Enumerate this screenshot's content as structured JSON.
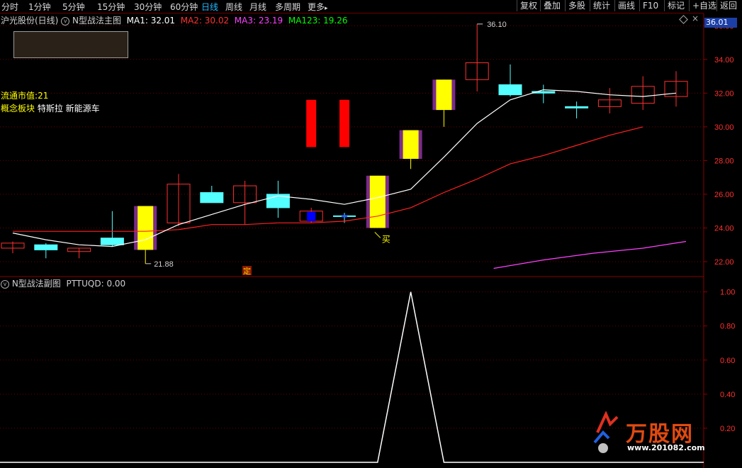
{
  "toolbar": {
    "periods": [
      "分时",
      "1分钟",
      "5分钟",
      "15分钟",
      "30分钟",
      "60分钟",
      "日线",
      "周线",
      "月线",
      "多周期",
      "更多"
    ],
    "more_arrow": "▸",
    "active_index": 6,
    "right_buttons": [
      "复权",
      "叠加",
      "多股",
      "统计",
      "画线",
      "F10",
      "标记",
      "+自选",
      "返回"
    ]
  },
  "main_panel": {
    "stock_title": "沪光股份(日线)",
    "indicator_name": "N型战法主图",
    "collapse_icon": "v",
    "ma": [
      {
        "label": "MA1: 32.01",
        "color": "#ffffff"
      },
      {
        "label": "MA2: 30.02",
        "color": "#ff3030"
      },
      {
        "label": "MA3: 23.19",
        "color": "#ff40ff"
      },
      {
        "label": "MA123: 19.26",
        "color": "#00ff00"
      }
    ],
    "info_lines": [
      {
        "label": "流通市值",
        "value": "21"
      },
      {
        "label": "概念板块",
        "value": "特斯拉 新能源车"
      }
    ],
    "last_price_tag": "36.01",
    "close_icon": "×",
    "annotations": {
      "high": "36.10",
      "low": "21.88",
      "buy": "买",
      "ding": "定"
    }
  },
  "sub_panel": {
    "title": "N型战法副图",
    "indicator_label": "PTTUQD: 0.00"
  },
  "watermark": {
    "brand": "万股网",
    "url": "www.201082.com"
  },
  "chart_data": [
    {
      "type": "candlestick",
      "y_ticks": [
        "22.00",
        "24.00",
        "26.00",
        "28.00",
        "30.00",
        "32.00",
        "34.00",
        "36.00"
      ],
      "ylim": [
        21.2,
        36.6
      ],
      "candles": [
        {
          "o": 22.8,
          "h": 23.2,
          "l": 22.5,
          "c": 23.1,
          "k": "up"
        },
        {
          "o": 23.0,
          "h": 23.1,
          "l": 22.2,
          "c": 22.7,
          "k": "down"
        },
        {
          "o": 22.8,
          "h": 22.8,
          "l": 22.2,
          "c": 22.6,
          "k": "up"
        },
        {
          "o": 23.0,
          "h": 25.0,
          "l": 22.9,
          "c": 23.4,
          "k": "down"
        },
        {
          "o": 22.7,
          "h": 25.3,
          "l": 21.88,
          "c": 25.3,
          "k": "signal"
        },
        {
          "o": 24.3,
          "h": 27.2,
          "l": 24.1,
          "c": 26.6,
          "k": "up"
        },
        {
          "o": 26.1,
          "h": 26.5,
          "l": 25.5,
          "c": 25.5,
          "k": "down"
        },
        {
          "o": 26.5,
          "h": 26.8,
          "l": 24.2,
          "c": 25.5,
          "k": "up"
        },
        {
          "o": 26.0,
          "h": 26.8,
          "l": 24.6,
          "c": 25.2,
          "k": "down"
        },
        {
          "o": 25.0,
          "h": 25.2,
          "l": 24.3,
          "c": 24.4,
          "k": "blue"
        },
        {
          "o": 24.8,
          "h": 24.9,
          "l": 24.3,
          "c": 24.7,
          "k": "doji"
        },
        {
          "o": 24.0,
          "h": 27.1,
          "l": 24.0,
          "c": 27.1,
          "k": "signal"
        },
        {
          "o": 28.1,
          "h": 29.8,
          "l": 27.5,
          "c": 29.8,
          "k": "signal"
        },
        {
          "o": 31.0,
          "h": 32.8,
          "l": 30.0,
          "c": 32.8,
          "k": "signal"
        },
        {
          "o": 32.8,
          "h": 36.1,
          "l": 32.1,
          "c": 33.8,
          "k": "up"
        },
        {
          "o": 32.5,
          "h": 33.7,
          "l": 31.8,
          "c": 31.9,
          "k": "down"
        },
        {
          "o": 32.1,
          "h": 32.5,
          "l": 31.4,
          "c": 32.0,
          "k": "down"
        },
        {
          "o": 31.2,
          "h": 31.5,
          "l": 30.5,
          "c": 31.2,
          "k": "down"
        },
        {
          "o": 31.2,
          "h": 32.3,
          "l": 30.8,
          "c": 31.6,
          "k": "up"
        },
        {
          "o": 31.4,
          "h": 33.0,
          "l": 31.0,
          "c": 32.4,
          "k": "up"
        },
        {
          "o": 31.8,
          "h": 33.3,
          "l": 31.2,
          "c": 32.7,
          "k": "up"
        }
      ],
      "red_bars": [
        {
          "index": 9,
          "top": 31.6,
          "bottom": 28.8
        },
        {
          "index": 10,
          "top": 31.6,
          "bottom": 28.8
        }
      ],
      "ma1": [
        23.7,
        23.3,
        23.0,
        22.9,
        23.3,
        24.2,
        24.8,
        25.4,
        25.9,
        25.7,
        25.4,
        25.8,
        26.3,
        28.2,
        30.2,
        31.6,
        32.2,
        32.1,
        31.9,
        31.8,
        32.0
      ],
      "ma2": [
        23.8,
        23.8,
        23.8,
        23.8,
        23.8,
        23.9,
        24.2,
        24.2,
        24.3,
        24.3,
        24.4,
        24.7,
        25.2,
        26.1,
        26.9,
        27.8,
        28.3,
        28.9,
        29.5,
        30.0
      ],
      "ma2_start": 0,
      "ma3": [
        21.6,
        22.1,
        22.5,
        22.8,
        23.2
      ],
      "ma3_x_indices": [
        14.5,
        16,
        17.5,
        19,
        20.3
      ]
    },
    {
      "type": "line",
      "y_ticks": [
        "0.20",
        "0.40",
        "0.60",
        "0.80",
        "1.00"
      ],
      "ylim": [
        0,
        1.04
      ],
      "values": [
        0,
        0,
        0,
        0,
        0,
        0,
        0,
        0,
        0,
        0,
        0,
        0,
        1,
        0,
        0,
        0,
        0,
        0,
        0,
        0,
        0
      ],
      "line_start_index": 10,
      "line_end_index": 14
    }
  ]
}
